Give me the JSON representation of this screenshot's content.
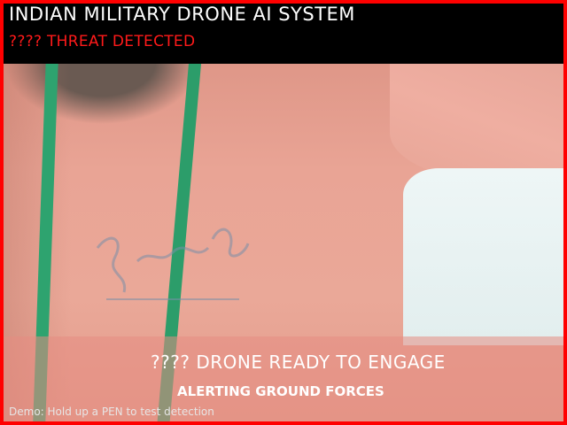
{
  "header": {
    "title": "INDIAN MILITARY DRONE AI SYSTEM",
    "threat_status": "???? THREAT DETECTED"
  },
  "alert": {
    "engage_text": "???? DRONE READY TO ENGAGE",
    "ground_text": "ALERTING GROUND FORCES",
    "demo_hint": "Demo: Hold up a PEN to test detection"
  },
  "colors": {
    "alert_border": "#ff0000",
    "threat_text": "#ff1a1a",
    "header_background": "#000000",
    "lanyard": "#2ea36f"
  }
}
